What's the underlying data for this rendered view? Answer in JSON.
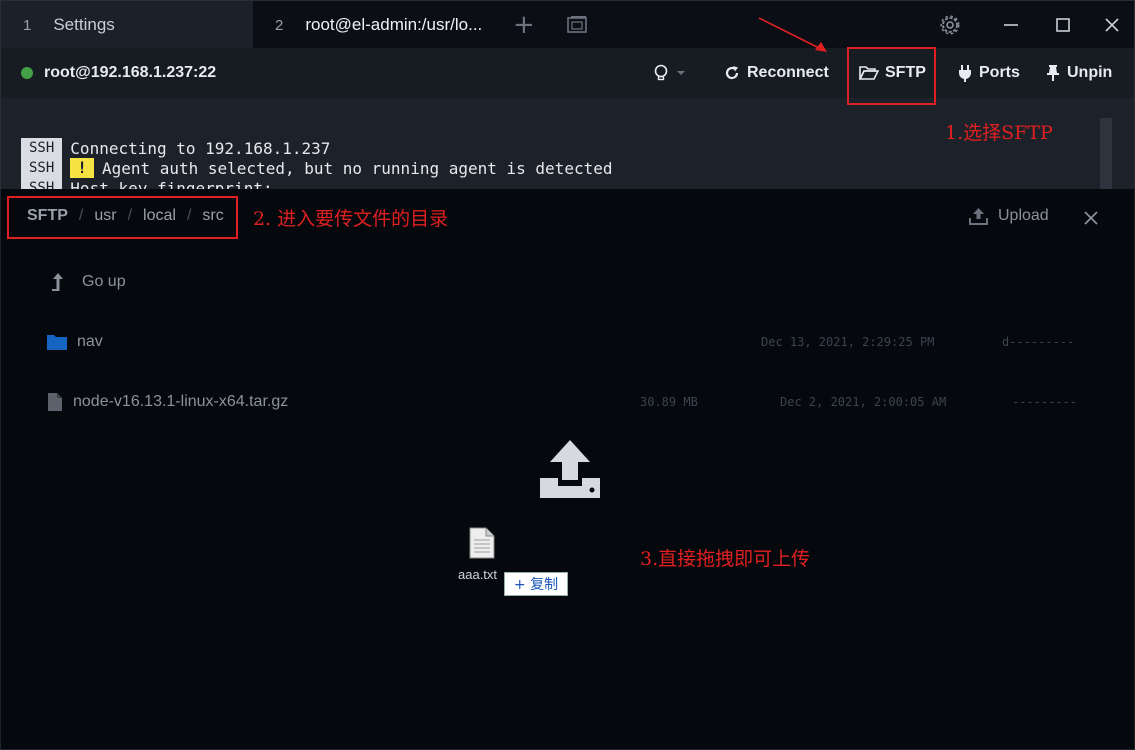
{
  "tabs": [
    {
      "num": "1",
      "label": "Settings"
    },
    {
      "num": "2",
      "label": "root@el-admin:/usr/lo..."
    }
  ],
  "header": {
    "connection": "root@192.168.1.237:22",
    "status_color": "#43a047",
    "reconnect_label": "Reconnect",
    "sftp_label": "SFTP",
    "ports_label": "Ports",
    "unpin_label": "Unpin"
  },
  "terminal": {
    "tag": "SSH",
    "lines": [
      "Connecting to 192.168.1.237",
      "Agent auth selected, but no running agent is detected",
      "Host key fingerprint:"
    ],
    "warn_symbol": "!"
  },
  "sftp": {
    "breadcrumb": [
      "SFTP",
      "usr",
      "local",
      "src"
    ],
    "upload_label": "Upload",
    "go_up_label": "Go up",
    "files": [
      {
        "name": "nav",
        "type": "folder",
        "size": "",
        "date": "Dec 13, 2021, 2:29:25 PM",
        "mode": "d---------"
      },
      {
        "name": "node-v16.13.1-linux-x64.tar.gz",
        "type": "file",
        "size": "30.89 MB",
        "date": "Dec 2, 2021, 2:00:05 AM",
        "mode": "---------"
      }
    ],
    "drag_file_name": "aaa.txt",
    "copy_badge": "+ 复制"
  },
  "annotations": {
    "step1": "1.选择SFTP",
    "step2": "2. 进入要传文件的目录",
    "step3": "3.直接拖拽即可上传",
    "color": "#e02020"
  }
}
